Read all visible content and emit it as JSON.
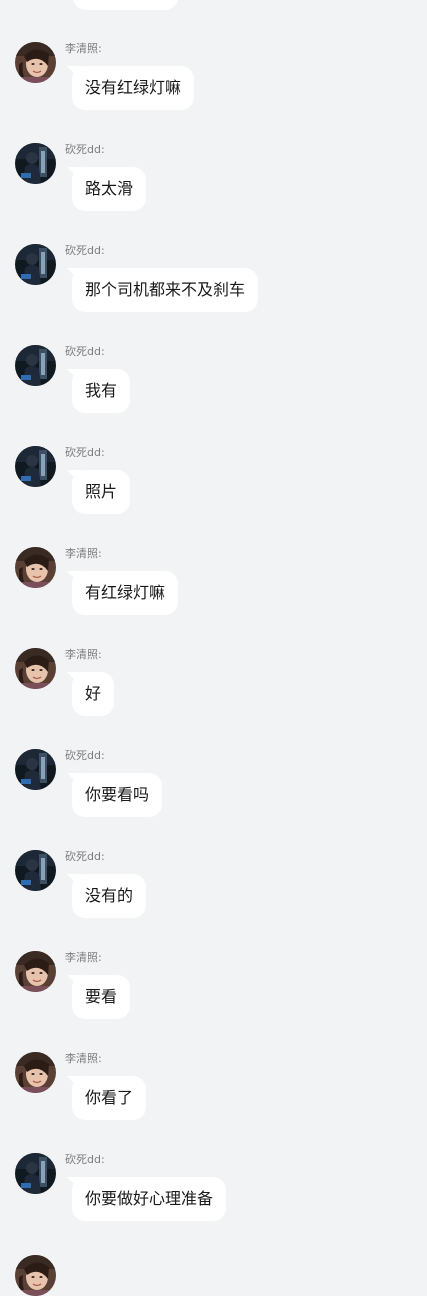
{
  "messages": [
    {
      "sender": "李清照:",
      "text": "没有红绿灯嘛",
      "avatar": "avatar-li"
    },
    {
      "sender": "砍死dd:",
      "text": "路太滑",
      "avatar": "avatar-dd"
    },
    {
      "sender": "砍死dd:",
      "text": "那个司机都来不及刹车",
      "avatar": "avatar-dd"
    },
    {
      "sender": "砍死dd:",
      "text": "我有",
      "avatar": "avatar-dd"
    },
    {
      "sender": "砍死dd:",
      "text": "照片",
      "avatar": "avatar-dd"
    },
    {
      "sender": "李清照:",
      "text": "有红绿灯嘛",
      "avatar": "avatar-li"
    },
    {
      "sender": "李清照:",
      "text": "好",
      "avatar": "avatar-li"
    },
    {
      "sender": "砍死dd:",
      "text": "你要看吗",
      "avatar": "avatar-dd"
    },
    {
      "sender": "砍死dd:",
      "text": "没有的",
      "avatar": "avatar-dd"
    },
    {
      "sender": "李清照:",
      "text": "要看",
      "avatar": "avatar-li"
    },
    {
      "sender": "李清照:",
      "text": "你看了",
      "avatar": "avatar-li"
    },
    {
      "sender": "砍死dd:",
      "text": "你要做好心理准备",
      "avatar": "avatar-dd"
    }
  ],
  "colors": {
    "background": "#f2f3f5",
    "bubble": "#ffffff",
    "sender_name": "#7d7d7d",
    "message_text": "#1a1a1a"
  }
}
